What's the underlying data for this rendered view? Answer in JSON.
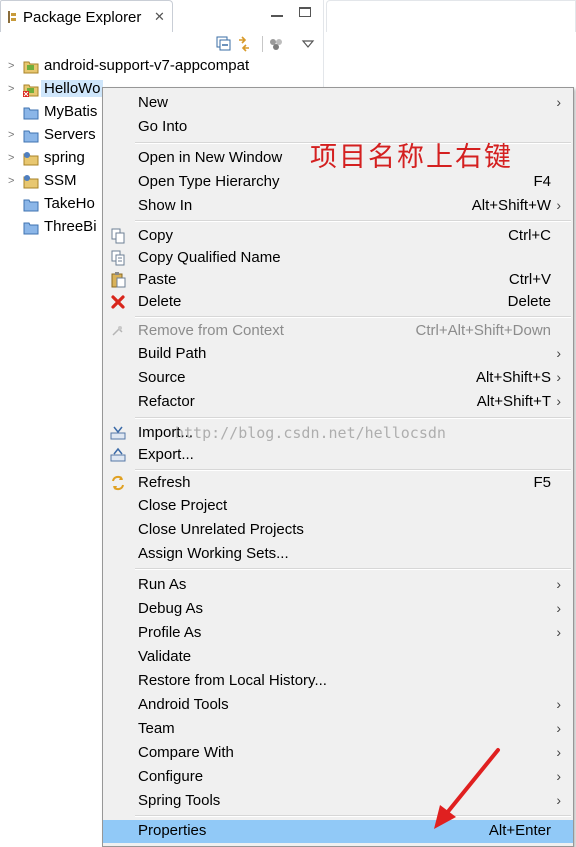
{
  "view": {
    "tab_title": "Package Explorer",
    "tab_close": "✕",
    "icons": [
      "package-explorer-icon",
      "close-icon",
      "minimize-icon",
      "maximize-icon",
      "collapse-all-icon",
      "link-editor-icon",
      "focus-task-icon",
      "view-menu-icon"
    ]
  },
  "tree": {
    "items": [
      {
        "label": "android-support-v7-appcompat",
        "icon": "android-project-icon",
        "expandable": true
      },
      {
        "label": "HelloWo",
        "icon": "android-project-error-icon",
        "expandable": true,
        "selected": true
      },
      {
        "label": "MyBatis",
        "icon": "folder-icon",
        "expandable": false
      },
      {
        "label": "Servers",
        "icon": "folder-icon",
        "expandable": true
      },
      {
        "label": "spring",
        "icon": "java-project-icon",
        "expandable": true
      },
      {
        "label": "SSM",
        "icon": "java-project-icon",
        "expandable": true
      },
      {
        "label": "TakeHo",
        "icon": "folder-icon",
        "expandable": false
      },
      {
        "label": "ThreeBi",
        "icon": "folder-icon",
        "expandable": false
      }
    ]
  },
  "menu": {
    "items": [
      {
        "label": "New",
        "accel": "",
        "submenu": true
      },
      {
        "label": "Go Into",
        "accel": ""
      },
      {
        "label": "Open in New Window",
        "accel": ""
      },
      {
        "label": "Open Type Hierarchy",
        "accel": "F4"
      },
      {
        "label": "Show In",
        "accel": "Alt+Shift+W",
        "submenu": true
      },
      {
        "label": "Copy",
        "accel": "Ctrl+C",
        "icon": "copy-icon"
      },
      {
        "label": "Copy Qualified Name",
        "accel": "",
        "icon": "copy-qualified-name-icon"
      },
      {
        "label": "Paste",
        "accel": "Ctrl+V",
        "icon": "paste-icon"
      },
      {
        "label": "Delete",
        "accel": "Delete",
        "icon": "delete-icon"
      },
      {
        "label": "Remove from Context",
        "accel": "Ctrl+Alt+Shift+Down",
        "disabled": true,
        "icon": "remove-from-context-icon"
      },
      {
        "label": "Build Path",
        "accel": "",
        "submenu": true
      },
      {
        "label": "Source",
        "accel": "Alt+Shift+S",
        "submenu": true
      },
      {
        "label": "Refactor",
        "accel": "Alt+Shift+T",
        "submenu": true
      },
      {
        "label": "Import...",
        "accel": "",
        "icon": "import-icon"
      },
      {
        "label": "Export...",
        "accel": "",
        "icon": "export-icon"
      },
      {
        "label": "Refresh",
        "accel": "F5",
        "icon": "refresh-icon"
      },
      {
        "label": "Close Project",
        "accel": ""
      },
      {
        "label": "Close Unrelated Projects",
        "accel": ""
      },
      {
        "label": "Assign Working Sets...",
        "accel": ""
      },
      {
        "label": "Run As",
        "accel": "",
        "submenu": true
      },
      {
        "label": "Debug As",
        "accel": "",
        "submenu": true
      },
      {
        "label": "Profile As",
        "accel": "",
        "submenu": true
      },
      {
        "label": "Validate",
        "accel": ""
      },
      {
        "label": "Restore from Local History...",
        "accel": ""
      },
      {
        "label": "Android Tools",
        "accel": "",
        "submenu": true
      },
      {
        "label": "Team",
        "accel": "",
        "submenu": true
      },
      {
        "label": "Compare With",
        "accel": "",
        "submenu": true
      },
      {
        "label": "Configure",
        "accel": "",
        "submenu": true
      },
      {
        "label": "Spring Tools",
        "accel": "",
        "submenu": true
      },
      {
        "label": "Properties",
        "accel": "Alt+Enter",
        "highlighted": true
      }
    ]
  },
  "watermark": "http://blog.csdn.net/hellocsdn",
  "annotation": "项目名称上右键",
  "colors": {
    "highlight": "#91c9f7",
    "annotation": "#d42020",
    "selection": "#cfe6fb"
  }
}
